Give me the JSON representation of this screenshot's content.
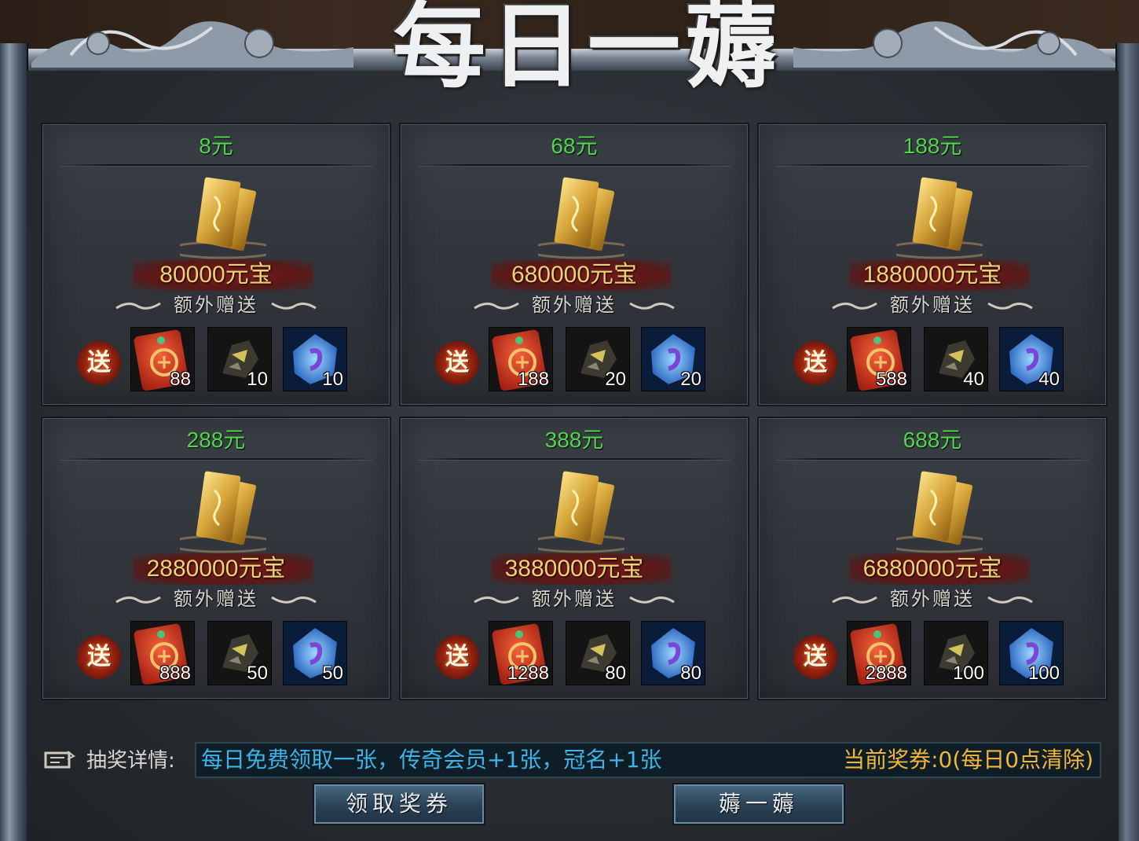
{
  "title": "每日一薅",
  "common": {
    "currency_suffix": "元宝",
    "extra_label": "额外赠送",
    "send_badge": "送"
  },
  "packages": [
    {
      "price": "8元",
      "ingot": "80000元宝",
      "items": [
        {
          "icon": "red-envelope-icon",
          "count": "88"
        },
        {
          "icon": "dark-ore-icon",
          "count": "10"
        },
        {
          "icon": "blue-crystal-icon",
          "count": "10"
        }
      ]
    },
    {
      "price": "68元",
      "ingot": "680000元宝",
      "items": [
        {
          "icon": "red-envelope-icon",
          "count": "188"
        },
        {
          "icon": "dark-ore-icon",
          "count": "20"
        },
        {
          "icon": "blue-crystal-icon",
          "count": "20"
        }
      ]
    },
    {
      "price": "188元",
      "ingot": "1880000元宝",
      "items": [
        {
          "icon": "red-envelope-icon",
          "count": "588"
        },
        {
          "icon": "dark-ore-icon",
          "count": "40"
        },
        {
          "icon": "blue-crystal-icon",
          "count": "40"
        }
      ]
    },
    {
      "price": "288元",
      "ingot": "2880000元宝",
      "items": [
        {
          "icon": "red-envelope-icon",
          "count": "888"
        },
        {
          "icon": "dark-ore-icon",
          "count": "50"
        },
        {
          "icon": "blue-crystal-icon",
          "count": "50"
        }
      ]
    },
    {
      "price": "388元",
      "ingot": "3880000元宝",
      "items": [
        {
          "icon": "red-envelope-icon",
          "count": "1288"
        },
        {
          "icon": "dark-ore-icon",
          "count": "80"
        },
        {
          "icon": "blue-crystal-icon",
          "count": "80"
        }
      ]
    },
    {
      "price": "688元",
      "ingot": "6880000元宝",
      "items": [
        {
          "icon": "red-envelope-icon",
          "count": "2888"
        },
        {
          "icon": "dark-ore-icon",
          "count": "100"
        },
        {
          "icon": "blue-crystal-icon",
          "count": "100"
        }
      ]
    }
  ],
  "info": {
    "label": "抽奖详情:",
    "details": "每日免费领取一张，传奇会员+1张，冠名+1张",
    "current_tickets": "当前奖券:0(每日0点清除)"
  },
  "buttons": {
    "claim": "领取奖券",
    "draw": "薅一薅"
  },
  "colors": {
    "price_green": "#4fd64b",
    "ingot_gold": "#f1cf74",
    "info_blue": "#3fb3e6",
    "tickets_orange": "#f0b53c"
  }
}
